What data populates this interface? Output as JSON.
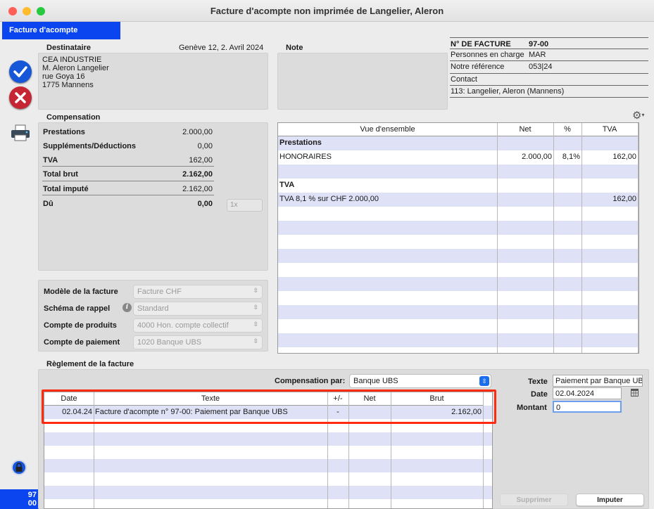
{
  "window": {
    "title": "Facture d'acompte non imprimée  de Langelier, Aleron"
  },
  "tab": {
    "label": "Facture d'acompte"
  },
  "sidebar": {
    "counter_line1": "97",
    "counter_line2": "00"
  },
  "destinataire": {
    "label": "Destinataire",
    "date": "Genève 12, 2. Avril 2024",
    "lines": [
      "CEA INDUSTRIE",
      "M. Aleron Langelier",
      "rue Goya 16",
      "1775 Mannens"
    ]
  },
  "note": {
    "label": "Note"
  },
  "invoice_info": {
    "no_label": "N° DE FACTURE",
    "no_value": "97-00",
    "charge_label": "Personnes en charge",
    "charge_value": "MAR",
    "ref_label": "Notre référence",
    "ref_value": "053|24",
    "contact_label": "Contact",
    "contact_value": "113: Langelier, Aleron (Mannens)"
  },
  "compensation": {
    "title": "Compensation",
    "rows": [
      {
        "label": "Prestations",
        "value": "2.000,00"
      },
      {
        "label": "Suppléments/Déductions",
        "value": "0,00"
      },
      {
        "label": "TVA",
        "value": "162,00"
      },
      {
        "label": "Total brut",
        "value": "2.162,00"
      },
      {
        "label": "Total imputé",
        "value": "2.162,00"
      },
      {
        "label": "Dû",
        "value": "0,00"
      }
    ],
    "multiplier": "1x"
  },
  "settings": {
    "rows": [
      {
        "label": "Modèle de la facture",
        "value": "Facture CHF"
      },
      {
        "label": "Schéma de rappel",
        "value": "Standard"
      },
      {
        "label": "Compte de produits",
        "value": "4000 Hon. compte collectif"
      },
      {
        "label": "Compte de paiement",
        "value": "1020 Banque UBS"
      }
    ]
  },
  "overview": {
    "headers": [
      "Vue d'ensemble",
      "Net",
      "%",
      "TVA"
    ],
    "rows": [
      {
        "label": "Prestations",
        "net": "",
        "pct": "",
        "tva": "",
        "bold": true
      },
      {
        "label": "HONORAIRES",
        "net": "2.000,00",
        "pct": "8,1%",
        "tva": "162,00",
        "bold": false
      },
      {
        "label": "",
        "net": "",
        "pct": "",
        "tva": "",
        "bold": false
      },
      {
        "label": "TVA",
        "net": "",
        "pct": "",
        "tva": "",
        "bold": true
      },
      {
        "label": "TVA 8,1 % sur CHF 2.000,00",
        "net": "",
        "pct": "",
        "tva": "162,00",
        "bold": false
      }
    ]
  },
  "reglement": {
    "title": "Règlement de la facture",
    "compensation_par_label": "Compensation par:",
    "compensation_par_value": "Banque UBS",
    "headers": [
      "Date",
      "Texte",
      "+/-",
      "Net",
      "Brut"
    ],
    "rows": [
      {
        "date": "02.04.24",
        "texte": "Facture d'acompte n° 97-00: Paiement par Banque UBS",
        "pm": "-",
        "net": "",
        "brut": "2.162,00"
      }
    ],
    "texte_label": "Texte",
    "texte_value": "Paiement par Banque UB",
    "date_label": "Date",
    "date_value": "02.04.2024",
    "montant_label": "Montant",
    "montant_value": "0",
    "delete_label": "Supprimer",
    "apply_label": "Imputer"
  },
  "colors": {
    "accent": "#0a45f0",
    "row_alt": "#dfe1f7",
    "highlight": "#ff2a10"
  }
}
